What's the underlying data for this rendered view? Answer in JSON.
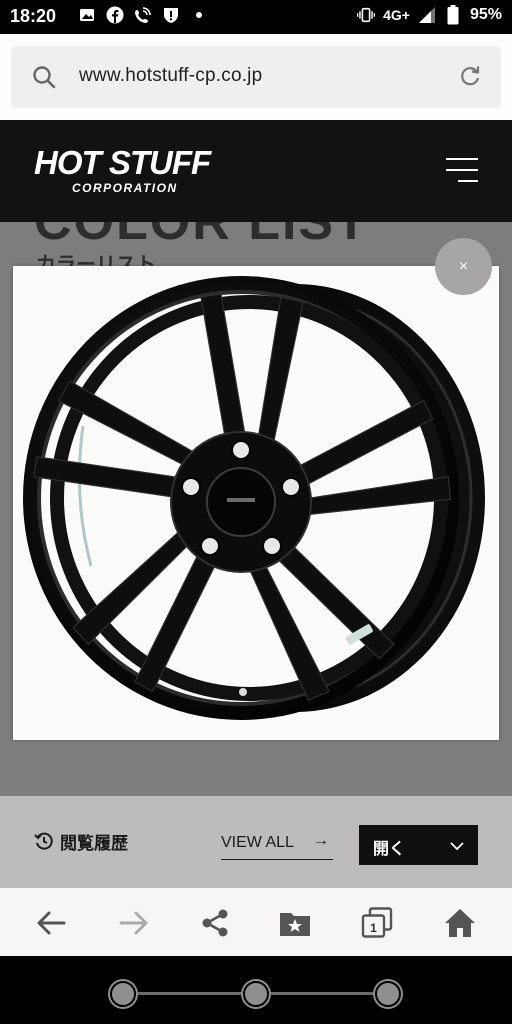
{
  "status_bar": {
    "time": "18:20",
    "network": "4G+",
    "battery": "95%",
    "icons": [
      "image-icon",
      "facebook-icon",
      "wifi-calling-icon",
      "alert-icon",
      "dot-icon",
      "vibrate-icon",
      "signal-icon",
      "battery-icon"
    ]
  },
  "browser": {
    "url": "www.hotstuff-cp.co.jp"
  },
  "site_header": {
    "logo_main": "HOT STUFF",
    "logo_sub": "CORPORATION"
  },
  "page": {
    "heading": "COLOR LIST",
    "subheading": "カラーリスト"
  },
  "modal": {
    "close_label": "×",
    "image": "black-alloy-wheel-image"
  },
  "history_bar": {
    "label": "閲覧履歴",
    "view_all": "VIEW ALL",
    "view_all_arrow": "→",
    "open_label": "開く"
  },
  "colors": {
    "header_bg": "#141210",
    "overlay_bg": "#7e7d7b",
    "history_bg": "#bdbcba",
    "button_dark": "#0f0f0f"
  }
}
